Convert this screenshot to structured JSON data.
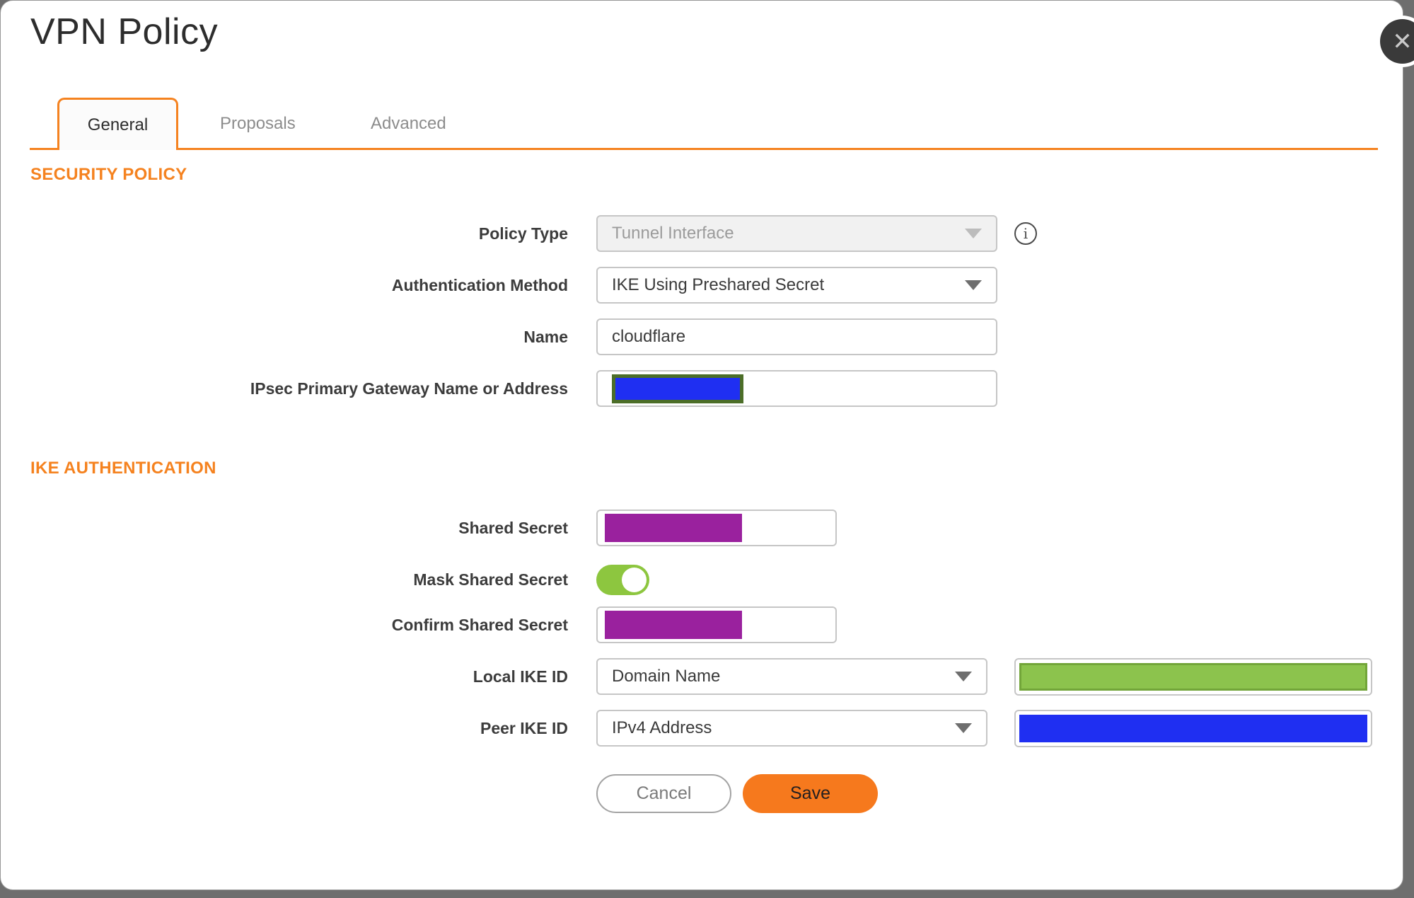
{
  "modal": {
    "title": "VPN Policy"
  },
  "icons": {
    "close": "✕",
    "info": "i",
    "caret": "▼"
  },
  "tabs": [
    {
      "label": "General",
      "active": true
    },
    {
      "label": "Proposals",
      "active": false
    },
    {
      "label": "Advanced",
      "active": false
    }
  ],
  "sections": {
    "security_policy": "SECURITY POLICY",
    "ike_authentication": "IKE AUTHENTICATION"
  },
  "form": {
    "policy_type": {
      "label": "Policy Type",
      "value": "Tunnel Interface",
      "disabled": true
    },
    "authentication_method": {
      "label": "Authentication Method",
      "value": "IKE Using Preshared Secret"
    },
    "name": {
      "label": "Name",
      "value": "cloudflare"
    },
    "gateway": {
      "label": "IPsec Primary Gateway Name or Address",
      "value_redacted": true
    },
    "shared_secret": {
      "label": "Shared Secret",
      "value_redacted": true
    },
    "mask_shared_secret": {
      "label": "Mask Shared Secret",
      "enabled": true
    },
    "confirm_shared_secret": {
      "label": "Confirm Shared Secret",
      "value_redacted": true
    },
    "local_ike_id": {
      "label": "Local IKE ID",
      "value": "Domain Name",
      "id_value_redacted": true
    },
    "peer_ike_id": {
      "label": "Peer IKE ID",
      "value": "IPv4 Address",
      "id_value_redacted": true
    }
  },
  "buttons": {
    "cancel": "Cancel",
    "save": "Save"
  },
  "colors": {
    "accent_orange": "#f5821f",
    "save_orange": "#f6791d",
    "toggle_green": "#8dc63f",
    "redaction_purple": "#9a219e",
    "redaction_blue": "#1f2ff2",
    "redaction_blue_border": "#4c6e28",
    "redaction_green": "#8cc34d",
    "redaction_green_border": "#72a539",
    "backdrop_gray": "#6e6e6e"
  }
}
